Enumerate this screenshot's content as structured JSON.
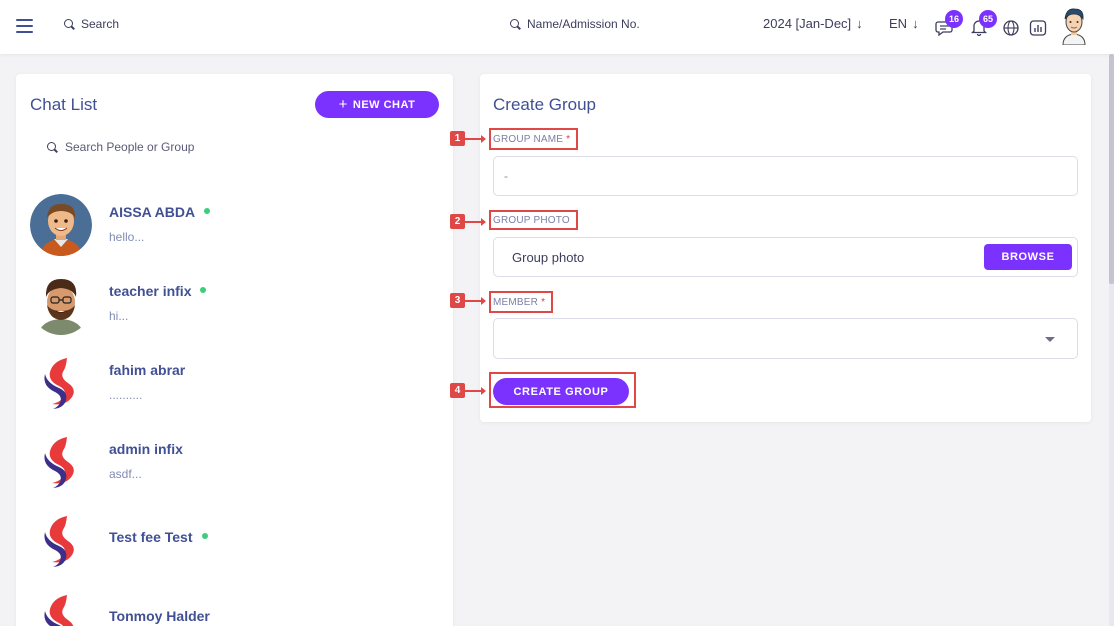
{
  "header": {
    "search_placeholder": "Search",
    "admission_search_placeholder": "Name/Admission No.",
    "academic_year": "2024 [Jan-Dec]",
    "language": "EN",
    "message_count": "16",
    "notification_count": "65",
    "icons": [
      "menu-icon",
      "search-icon",
      "arrow-down-icon",
      "message-icon",
      "bell-icon",
      "globe-icon",
      "chart-icon",
      "user-avatar"
    ]
  },
  "chat_list": {
    "title": "Chat List",
    "new_chat_label": "NEW CHAT",
    "search_placeholder": "Search People or Group",
    "chats": [
      {
        "name": "AISSA ABDA",
        "message": "hello...",
        "online": true,
        "avatar": "cartoon-man-orange"
      },
      {
        "name": "teacher infix",
        "message": "hi...",
        "online": true,
        "avatar": "cartoon-man-beard"
      },
      {
        "name": "fahim abrar",
        "message": "..........",
        "online": false,
        "avatar": "brand-logo"
      },
      {
        "name": "admin infix",
        "message": "asdf...",
        "online": false,
        "avatar": "brand-logo"
      },
      {
        "name": "Test fee Test",
        "message": "",
        "online": true,
        "avatar": "brand-logo"
      },
      {
        "name": "Tonmoy Halder",
        "message": "",
        "online": false,
        "avatar": "brand-logo"
      }
    ]
  },
  "create_group": {
    "title": "Create Group",
    "group_name_label": "GROUP NAME",
    "group_name_value": "-",
    "group_photo_label": "GROUP PHOTO",
    "group_photo_placeholder": "Group photo",
    "browse_label": "BROWSE",
    "member_label": "MEMBER",
    "create_label": "CREATE GROUP",
    "required_mark": "*",
    "steps": [
      "1",
      "2",
      "3",
      "4"
    ]
  },
  "colors": {
    "accent": "#7c32ff",
    "text": "#415094",
    "online": "#3cce7d",
    "highlight": "#e04848"
  }
}
